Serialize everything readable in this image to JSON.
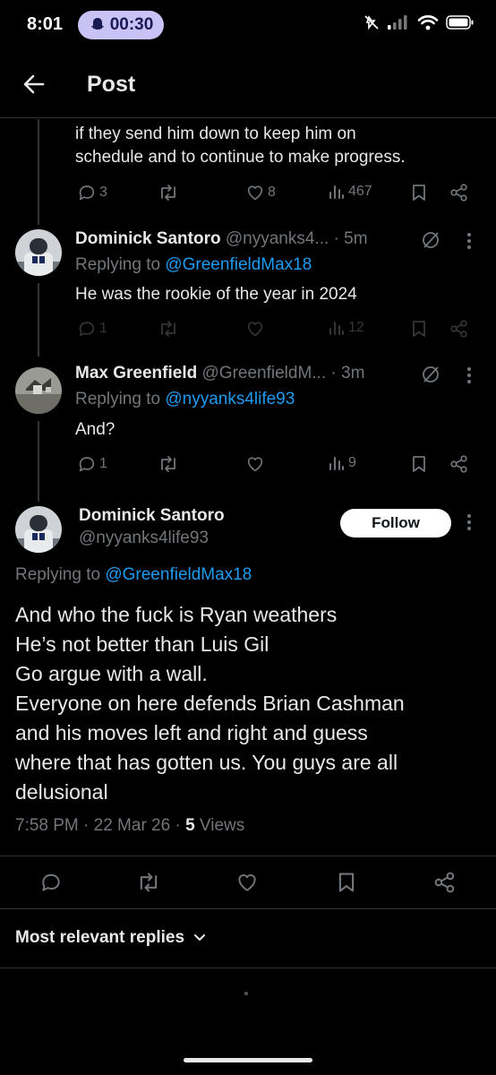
{
  "status_bar": {
    "time": "8:01",
    "timer": "00:30"
  },
  "header": {
    "title": "Post"
  },
  "prev_tweet": {
    "text_lines": [
      "if they send him down to keep him on",
      "schedule and to continue to make progress."
    ],
    "replies": "3",
    "likes": "8",
    "views": "467"
  },
  "reply1": {
    "name": "Dominick Santoro",
    "handle": "@nyyanks4...",
    "age": "· 5m",
    "replying_prefix": "Replying to ",
    "replying_to": "@GreenfieldMax18",
    "text": "He was the rookie of the year in 2024",
    "replies": "1",
    "views": "12"
  },
  "reply2": {
    "name": "Max Greenfield",
    "handle": "@GreenfieldM...",
    "age": "· 3m",
    "replying_prefix": "Replying to ",
    "replying_to": "@nyyanks4life93",
    "text": "And?",
    "replies": "1",
    "views": "9"
  },
  "main_tweet": {
    "name": "Dominick Santoro",
    "handle": "@nyyanks4life93",
    "follow_label": "Follow",
    "replying_prefix": "Replying to ",
    "replying_to": "@GreenfieldMax18",
    "text_lines": [
      "And who the fuck is Ryan weathers",
      "He’s not better than Luis Gil",
      "Go argue with a wall.",
      "Everyone on here defends Brian Cashman",
      "and his moves left and right and guess",
      "where that has gotten us. You guys are all",
      "delusional"
    ],
    "time": "7:58 PM · 22 Mar 26 · ",
    "views_count": "5",
    "views_label": " Views"
  },
  "sort": {
    "label": "Most relevant replies"
  },
  "colors": {
    "accent": "#1d9bf0",
    "muted": "#71767b",
    "text": "#e7e9ea",
    "bg": "#000000",
    "pill": "#c9c2f5"
  }
}
